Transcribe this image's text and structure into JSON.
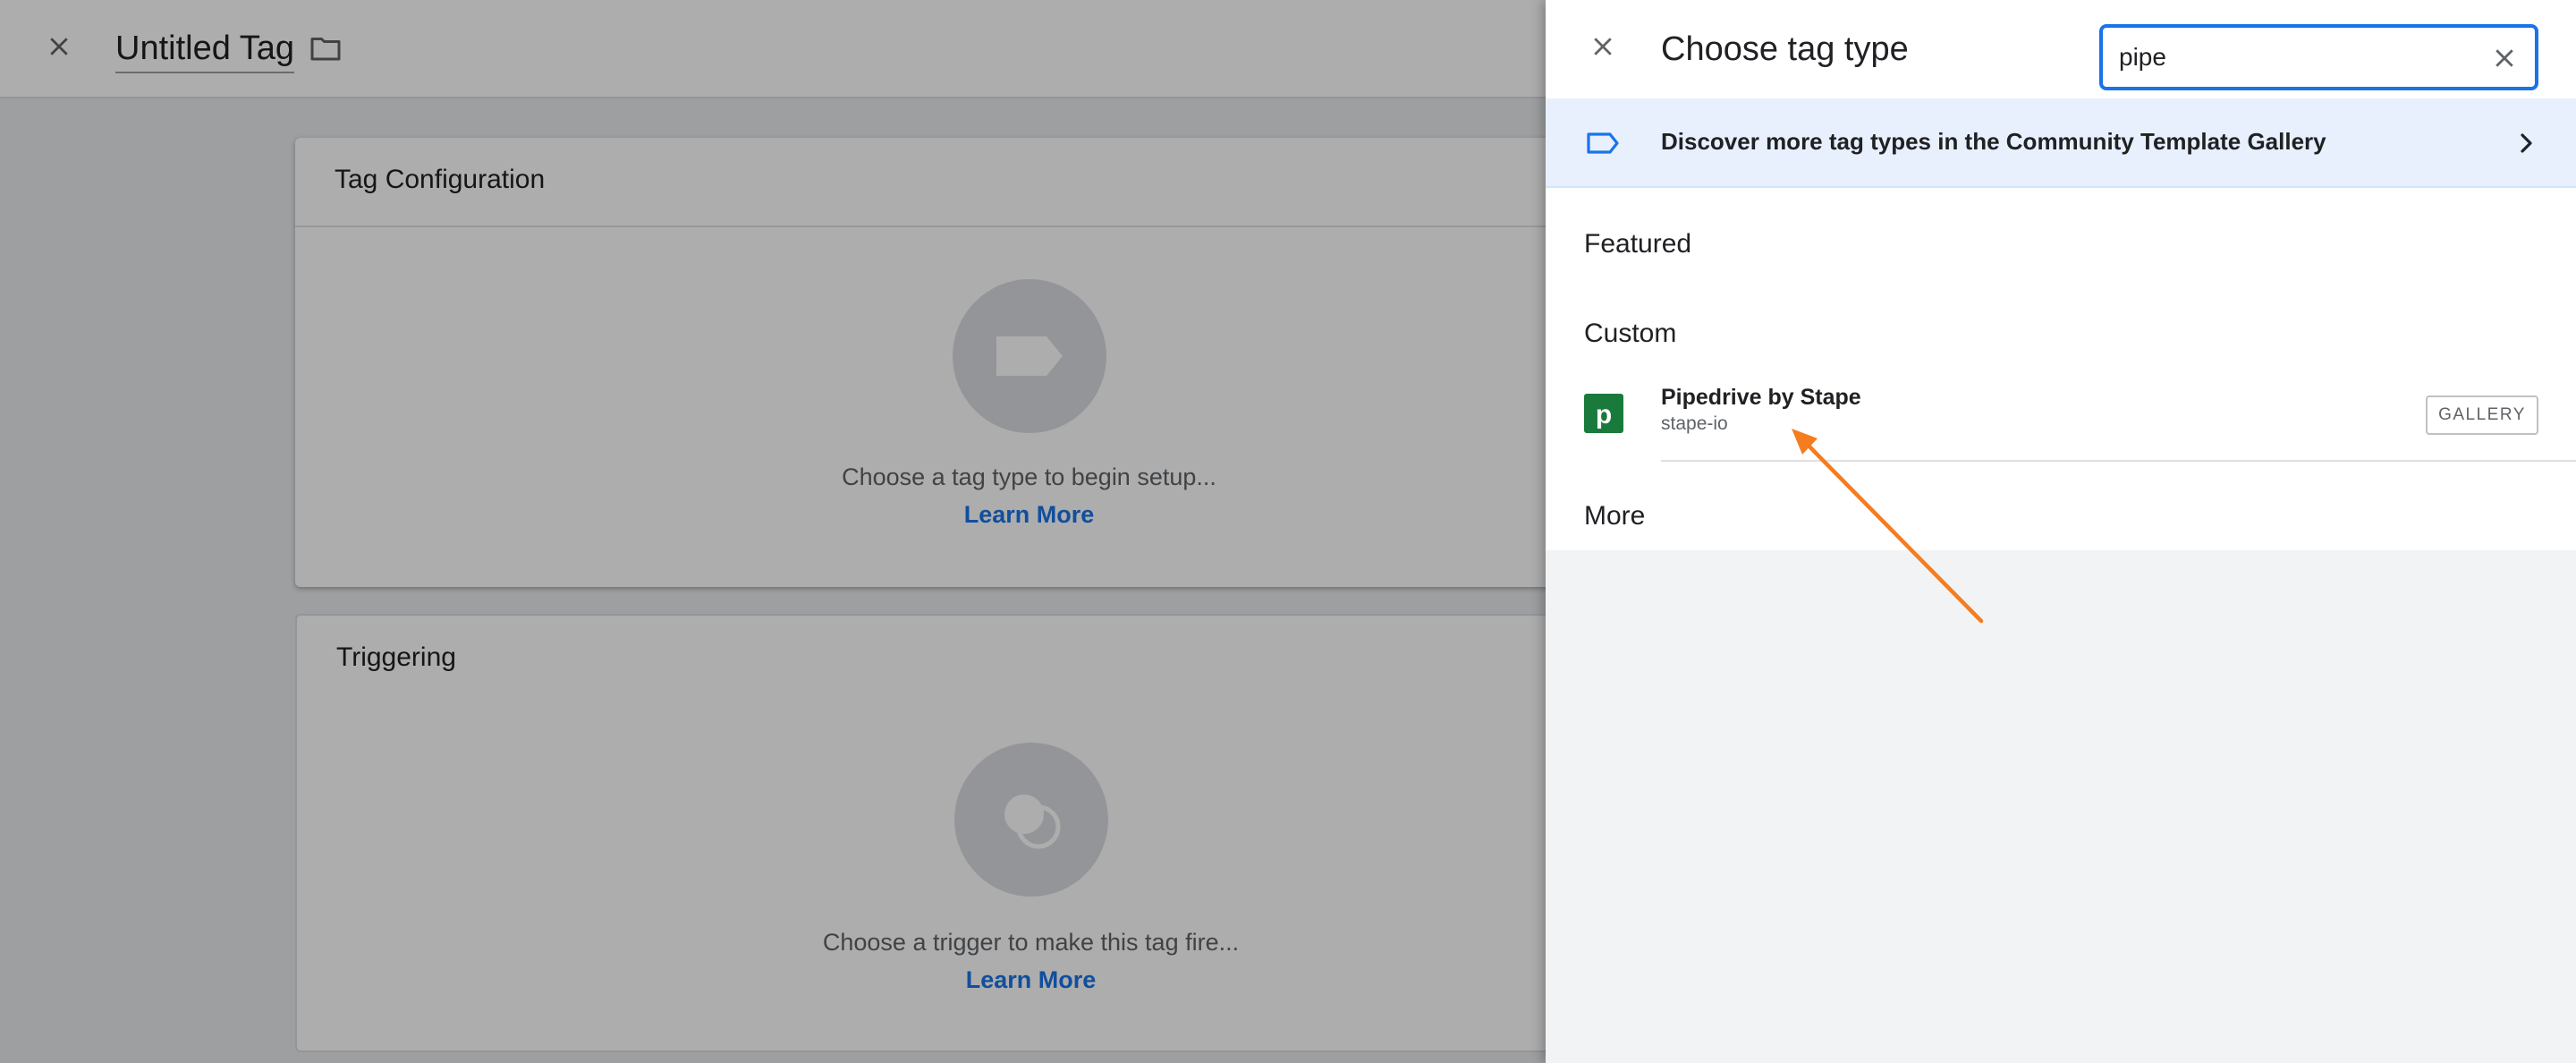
{
  "editor": {
    "tag_title": "Untitled Tag",
    "tag_configuration": {
      "title": "Tag Configuration",
      "hint": "Choose a tag type to begin setup...",
      "learn_more": "Learn More"
    },
    "triggering": {
      "title": "Triggering",
      "hint": "Choose a trigger to make this tag fire...",
      "learn_more": "Learn More"
    }
  },
  "panel": {
    "title": "Choose tag type",
    "search": {
      "value": "pipe",
      "placeholder": ""
    },
    "discover_banner": "Discover more tag types in the Community Template Gallery",
    "sections": {
      "featured": "Featured",
      "custom": "Custom",
      "more": "More"
    },
    "templates": [
      {
        "name": "Pipedrive by Stape",
        "owner": "stape-io",
        "badge": "GALLERY",
        "logo_letter": "p"
      }
    ]
  },
  "colors": {
    "accent": "#1a73e8",
    "banner_bg": "#e8f0fe",
    "pipedrive_green": "#1a7a3c",
    "annotation_arrow": "#f57c1f"
  },
  "icons": [
    "close-icon",
    "folder-icon",
    "tag-icon",
    "trigger-icon",
    "tag-outline-icon",
    "chevron-right-icon",
    "clear-icon",
    "pipedrive-logo-icon",
    "arrow-annotation-icon"
  ]
}
